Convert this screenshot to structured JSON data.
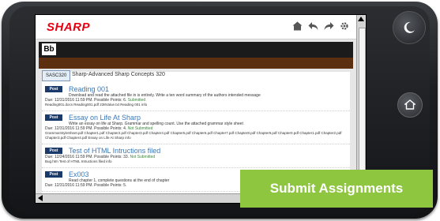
{
  "app": {
    "brand": "SHARP",
    "bb_logo": "Bb"
  },
  "top_icons": [
    "home-icon",
    "reply-icon",
    "forward-icon",
    "gear-icon"
  ],
  "course": {
    "tab": "SASC320",
    "title": "Sharp-Advanced Sharp Concepts 320"
  },
  "items": [
    {
      "post": "Post",
      "title": "Reading 001",
      "desc": "Download and read the attached file in is entirely.   Write a ten word summary of the authors intended message",
      "due": "Due: 12/31/2016 11:59 PM.  Possible Points: 6.",
      "status": "Submitted",
      "files": "Reading001.docs    Reading001.pdf    238Value.txt    Reading 001 info"
    },
    {
      "post": "Post",
      "title": "Essay on Life At Sharp",
      "desc": "Write an essay on life at Sharp.  Grammar and spelling count.  Use the attached grammar style sheet",
      "due": "Due: 12/31/2016 11:59 PM.  Possible Points: 4.",
      "status": "Not Submitted",
      "files": "GrammarStyleSheet.pdf   Chapter1.pdf   Chapter2.pdf   Chapter3.pdf   Chapter4.pdf   Chapter5.pdf   Chapter6.pdf   Chapter7.pdf   Chapter8.pdf   Chapter9.pdf   Chapter0.pdf   Chapter1.pdf   Chapter2.pdf   Chapter3.pdf   Chapter4.pdf   Essay on Life At Sharp info"
    },
    {
      "post": "Post",
      "title": "Test of HTML Intructions filed",
      "desc": "",
      "due": "Due: 12/24/2016 11:59 PM.  Possible Points: 33.",
      "status": "Not Submitted",
      "files": "Bug.htm    Test of HTML Intructions filed info"
    },
    {
      "post": "Post",
      "title": "Ex003",
      "desc": "Read chapter 1, complete questions at the end of chapter",
      "due": "Due: 12/31/2016 11:59 PM.  Possible Points: 5.",
      "status": "",
      "files": ""
    }
  ],
  "overlay": {
    "label": "Submit Assignments",
    "color": "#8ec63f"
  },
  "device_buttons": [
    "moon-icon",
    "home-icon"
  ]
}
